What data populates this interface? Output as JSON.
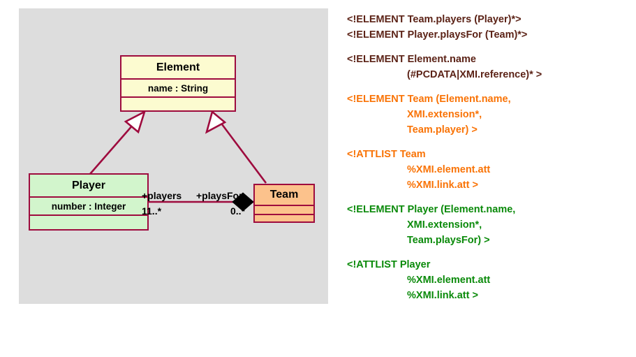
{
  "diagram": {
    "classes": [
      {
        "id": "element",
        "name": "Element",
        "attribute": "name : String",
        "operations": "",
        "fill": "#fcfbd0",
        "border": "#9e0b3e"
      },
      {
        "id": "player",
        "name": "Player",
        "attribute": "number : Integer",
        "operations": "",
        "fill": "#d2f5cc",
        "border": "#9e0b3e"
      },
      {
        "id": "team",
        "name": "Team",
        "attribute": "",
        "operations": "",
        "fill": "#fcc28c",
        "border": "#9e0b3e"
      }
    ],
    "association": {
      "role_left": "+players",
      "role_right": "+playsFor",
      "multiplicity_left": "11..*",
      "multiplicity_right": "0..*",
      "diamond": "filled-black"
    },
    "generalizations": [
      {
        "from": "Player",
        "to": "Element",
        "arrow": "hollow-triangle"
      },
      {
        "from": "Team",
        "to": "Element",
        "arrow": "hollow-triangle"
      }
    ],
    "background": "#dddddd",
    "line_color": "#9e0b3e"
  },
  "dtd": {
    "blocks": [
      {
        "color": "#5c2317",
        "color_name": "brown",
        "lines": [
          {
            "text": "<!ELEMENT Team.players (Player)*>",
            "indent": false
          },
          {
            "text": "<!ELEMENT Player.playsFor (Team)*>",
            "indent": false
          }
        ]
      },
      {
        "color": "#5c2317",
        "color_name": "brown",
        "lines": [
          {
            "text": "<!ELEMENT Element.name",
            "indent": false
          },
          {
            "text": "(#PCDATA|XMI.reference)* >",
            "indent": true
          }
        ]
      },
      {
        "color": "#f97306",
        "color_name": "orange",
        "lines": [
          {
            "text": "<!ELEMENT Team (Element.name,",
            "indent": false
          },
          {
            "text": "XMI.extension*,",
            "indent": true
          },
          {
            "text": "Team.player) >",
            "indent": true
          }
        ]
      },
      {
        "color": "#f97306",
        "color_name": "orange",
        "lines": [
          {
            "text": "<!ATTLIST Team",
            "indent": false
          },
          {
            "text": "%XMI.element.att",
            "indent": true
          },
          {
            "text": "%XMI.link.att >",
            "indent": true
          }
        ]
      },
      {
        "color": "#0a8a0a",
        "color_name": "green",
        "lines": [
          {
            "text": "<!ELEMENT Player (Element.name,",
            "indent": false
          },
          {
            "text": "XMI.extension*,",
            "indent": true
          },
          {
            "text": "Team.playsFor) >",
            "indent": true
          }
        ]
      },
      {
        "color": "#0a8a0a",
        "color_name": "green",
        "lines": [
          {
            "text": "<!ATTLIST Player",
            "indent": false
          },
          {
            "text": "%XMI.element.att",
            "indent": true
          },
          {
            "text": "%XMI.link.att >",
            "indent": true
          }
        ]
      }
    ]
  }
}
